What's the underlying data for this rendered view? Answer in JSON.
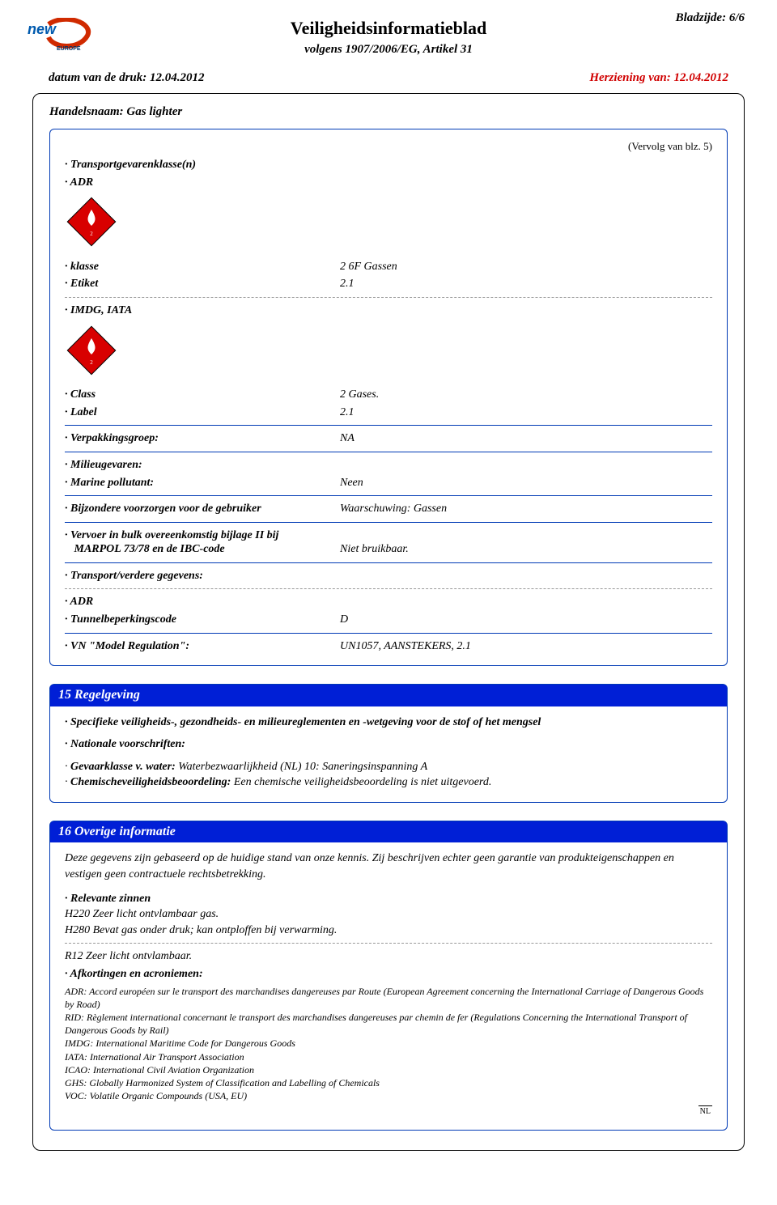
{
  "header": {
    "page_ref": "Bladzijde: 6/6",
    "title": "Veiligheidsinformatieblad",
    "subtitle": "volgens 1907/2006/EG, Artikel 31",
    "print_date": "datum van de druk: 12.04.2012",
    "revision": "Herziening van: 12.04.2012",
    "trade_name": "Handelsnaam: Gas lighter"
  },
  "sec14": {
    "continued": "(Vervolg van blz. 5)",
    "transport_classes_lbl": "Transportgevarenklasse(n)",
    "adr_lbl": "ADR",
    "klasse_lbl": "klasse",
    "klasse_val": "2   6F Gassen",
    "etiket_lbl": "Etiket",
    "etiket_val": "2.1",
    "imdg_lbl": "IMDG, IATA",
    "class_lbl": "Class",
    "class_val": "2 Gases.",
    "label_lbl": "Label",
    "label_val": "2.1",
    "packgroup_lbl": "Verpakkingsgroep:",
    "packgroup_val": "NA",
    "envhaz_lbl": "Milieugevaren:",
    "marine_lbl": "Marine pollutant:",
    "marine_val": "Neen",
    "precautions_lbl": "Bijzondere voorzorgen voor de gebruiker",
    "precautions_val": "Waarschuwing: Gassen",
    "bulk1": "Vervoer in bulk overeenkomstig bijlage II bij",
    "bulk2_lbl": "MARPOL 73/78 en de IBC-code",
    "bulk_val": "Niet bruikbaar.",
    "further_lbl": "Transport/verdere gegevens:",
    "adr2_lbl": "ADR",
    "tunnel_lbl": "Tunnelbeperkingscode",
    "tunnel_val": "D",
    "unmodel_lbl": "VN \"Model Regulation\":",
    "unmodel_val": "UN1057, AANSTEKERS, 2.1"
  },
  "sec15": {
    "title": "15 Regelgeving",
    "spec_lbl": "Specifieke veiligheids-, gezondheids- en milieureglementen en -wetgeving voor de stof of het mengsel",
    "nat_lbl": "Nationale voorschriften:",
    "gev_lbl": "Gevaarklasse v. water:",
    "gev_val": " Waterbezwaarlijkheid (NL) 10: Saneringsinspanning A",
    "csa_lbl": "Chemischeveiligheidsbeoordeling:",
    "csa_val": " Een chemische veiligheidsbeoordeling is niet uitgevoerd."
  },
  "sec16": {
    "title": "16 Overige informatie",
    "intro": "Deze gegevens zijn gebaseerd op de huidige stand van onze kennis. Zij beschrijven echter geen garantie van produkteigenschappen en vestigen geen contractuele rechtsbetrekking.",
    "rel_lbl": "Relevante zinnen",
    "h220": "H220 Zeer licht ontvlambaar gas.",
    "h280": "H280 Bevat gas onder druk; kan ontploffen bij verwarming.",
    "r12": "R12   Zeer licht ontvlambaar.",
    "abbr_lbl": "Afkortingen en acroniemen:",
    "abbr": [
      "ADR: Accord européen sur le transport des marchandises dangereuses par Route (European Agreement concerning the International Carriage of Dangerous Goods by Road)",
      "RID: Règlement international concernant le transport des marchandises dangereuses par chemin de fer (Regulations Concerning the International Transport of Dangerous Goods by Rail)",
      "IMDG: International Maritime Code for Dangerous Goods",
      "IATA: International Air Transport Association",
      "ICAO: International Civil Aviation Organization",
      "GHS: Globally Harmonized System of Classification and Labelling of Chemicals",
      "VOC: Volatile Organic Compounds (USA, EU)"
    ]
  },
  "footer": {
    "code": "NL"
  }
}
